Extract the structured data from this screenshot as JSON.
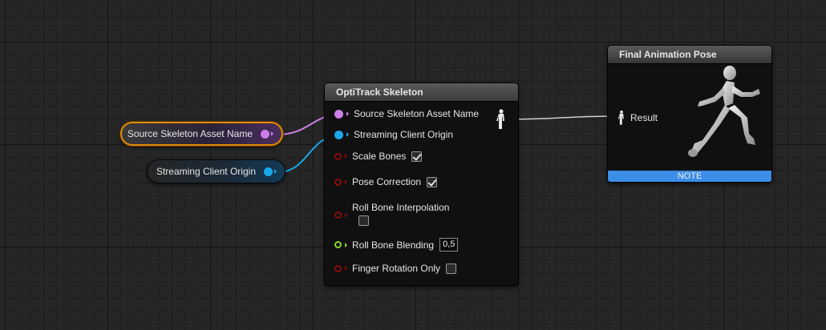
{
  "variables": {
    "source_skeleton": {
      "label": "Source Skeleton Asset Name",
      "color": "#cc7ee8",
      "selected": true
    },
    "streaming_client": {
      "label": "Streaming Client Origin",
      "color": "#1aa7ec"
    }
  },
  "opti_node": {
    "title": "OptiTrack Skeleton",
    "pins": {
      "source_skeleton": "Source Skeleton Asset Name",
      "streaming_client": "Streaming Client Origin",
      "scale_bones": "Scale Bones",
      "pose_correction": "Pose Correction",
      "roll_bone_interpolation": "Roll Bone Interpolation",
      "roll_bone_blending": "Roll Bone Blending",
      "finger_rotation_only": "Finger Rotation Only"
    },
    "values": {
      "scale_bones": true,
      "pose_correction": true,
      "roll_bone_interpolation": false,
      "roll_bone_blending": "0,5",
      "finger_rotation_only": false
    },
    "output_icon": "pose-figure-icon"
  },
  "final_node": {
    "title": "Final Animation Pose",
    "result_label": "Result",
    "note": "NOTE",
    "preview_icon": "running-mannequin-icon"
  },
  "colors": {
    "grid_bg": "#262626",
    "selection_outline": "#e08a00",
    "note_bar": "#3b8de6",
    "bool_pin": "#8a0b0b",
    "float_pin": "#8ed62a",
    "pose_wire": "#d0d0d0"
  }
}
